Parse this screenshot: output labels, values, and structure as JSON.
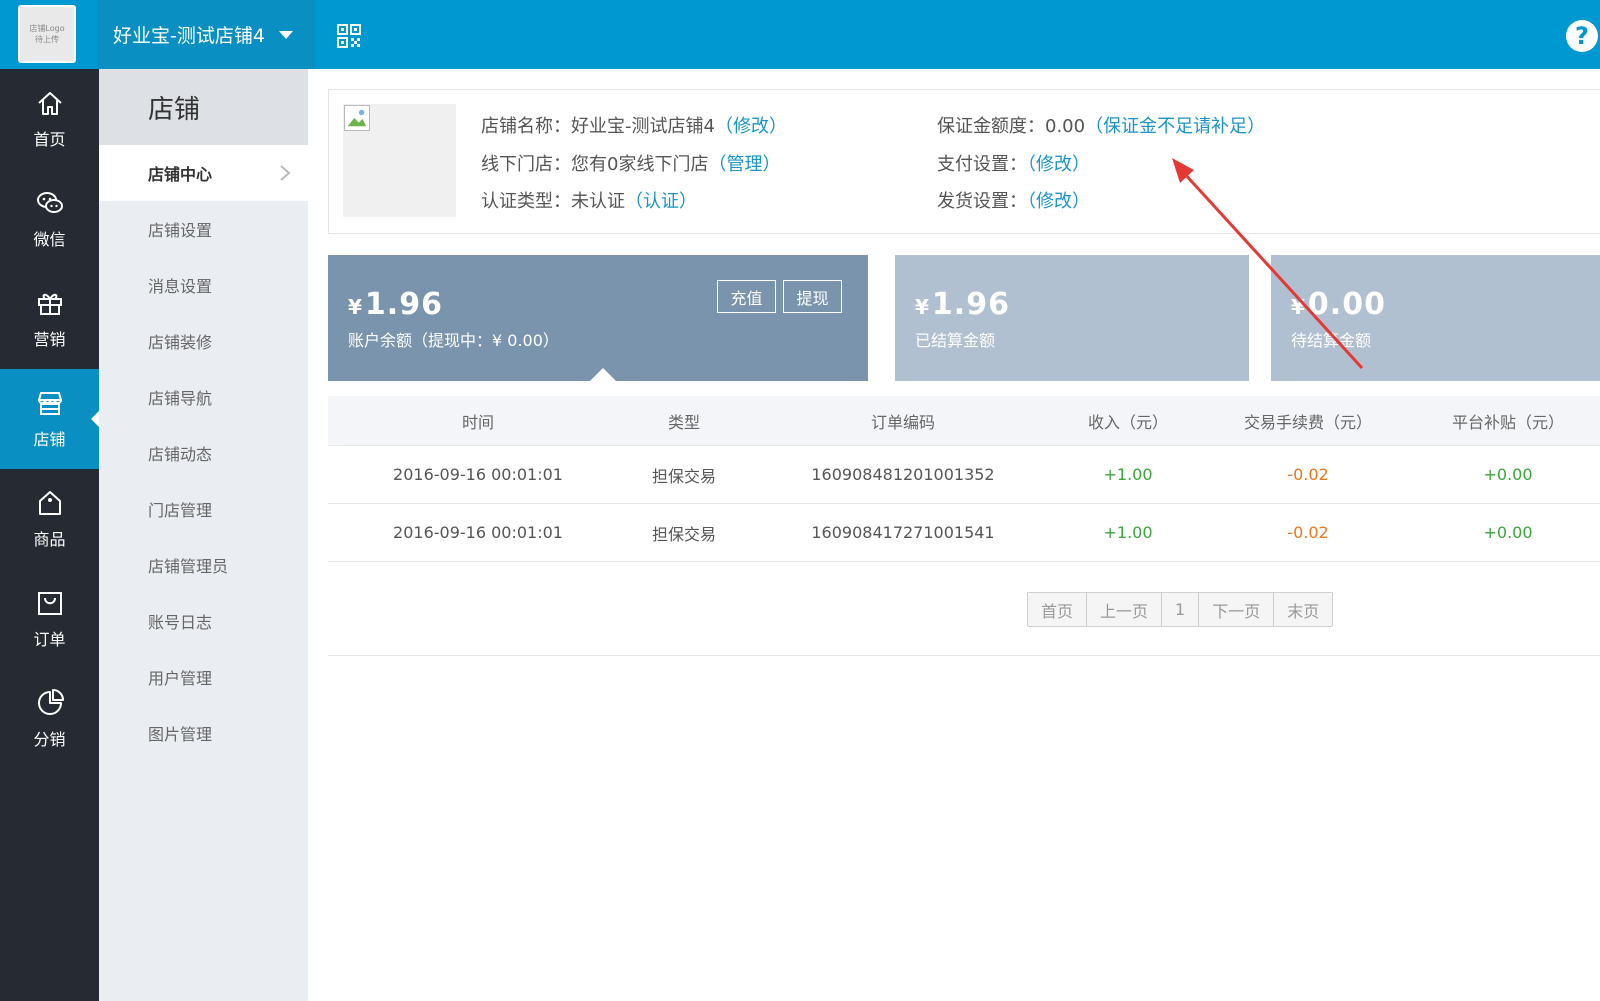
{
  "topbar": {
    "logo_line1": "店铺Logo",
    "logo_line2": "待上传",
    "store_name": "好业宝-测试店铺4",
    "help": "?"
  },
  "leftnav": {
    "items": [
      {
        "label": "首页",
        "icon": "home-icon"
      },
      {
        "label": "微信",
        "icon": "wechat-icon"
      },
      {
        "label": "营销",
        "icon": "gift-icon"
      },
      {
        "label": "店铺",
        "icon": "store-icon"
      },
      {
        "label": "商品",
        "icon": "product-tag-icon"
      },
      {
        "label": "订单",
        "icon": "order-bag-icon"
      },
      {
        "label": "分销",
        "icon": "pie-chart-icon"
      }
    ],
    "active": "店铺"
  },
  "subnav": {
    "title": "店铺",
    "items": [
      "店铺中心",
      "店铺设置",
      "消息设置",
      "店铺装修",
      "店铺导航",
      "店铺动态",
      "门店管理",
      "店铺管理员",
      "账号日志",
      "用户管理",
      "图片管理"
    ]
  },
  "info": {
    "name_label": "店铺名称：",
    "name_value": "好业宝-测试店铺4",
    "name_link": "（修改）",
    "offline_label": "线下门店：",
    "offline_value": "您有0家线下门店",
    "offline_link": "（管理）",
    "cert_label": "认证类型：",
    "cert_value": "未认证",
    "cert_link": "（认证）",
    "deposit_label": "保证金额度：",
    "deposit_value": "0.00",
    "deposit_link": "（保证金不足请补足）",
    "pay_label": "支付设置：",
    "pay_link": "（修改）",
    "ship_label": "发货设置：",
    "ship_link": "（修改）"
  },
  "cards": {
    "balance": {
      "yen": "¥",
      "amount": "1.96",
      "desc": "账户余额（提现中：¥ 0.00）",
      "btn_recharge": "充值",
      "btn_withdraw": "提现"
    },
    "settled": {
      "yen": "¥",
      "amount": "1.96",
      "desc": "已结算金额"
    },
    "pending": {
      "yen": "¥",
      "amount": "0.00",
      "desc": "待结算金额"
    }
  },
  "table": {
    "headers": [
      "时间",
      "类型",
      "订单编码",
      "收入（元）",
      "交易手续费（元）",
      "平台补贴（元）"
    ],
    "rows": [
      {
        "time": "2016-09-16 00:01:01",
        "type": "担保交易",
        "order": "160908481201001352",
        "income": "+1.00",
        "fee": "-0.02",
        "subsidy": "+0.00"
      },
      {
        "time": "2016-09-16 00:01:01",
        "type": "担保交易",
        "order": "160908417271001541",
        "income": "+1.00",
        "fee": "-0.02",
        "subsidy": "+0.00"
      }
    ]
  },
  "pager": {
    "first": "首页",
    "prev": "上一页",
    "page": "1",
    "next": "下一页",
    "last": "末页"
  },
  "colors": {
    "topbar": "#0098d0",
    "nav_dark": "#262b33",
    "link": "#1a95c9",
    "card_main": "#7b94ae",
    "card_light": "#b1c0d0",
    "income": "#3aa53a",
    "fee": "#e8771c",
    "arrow": "#e53935"
  }
}
